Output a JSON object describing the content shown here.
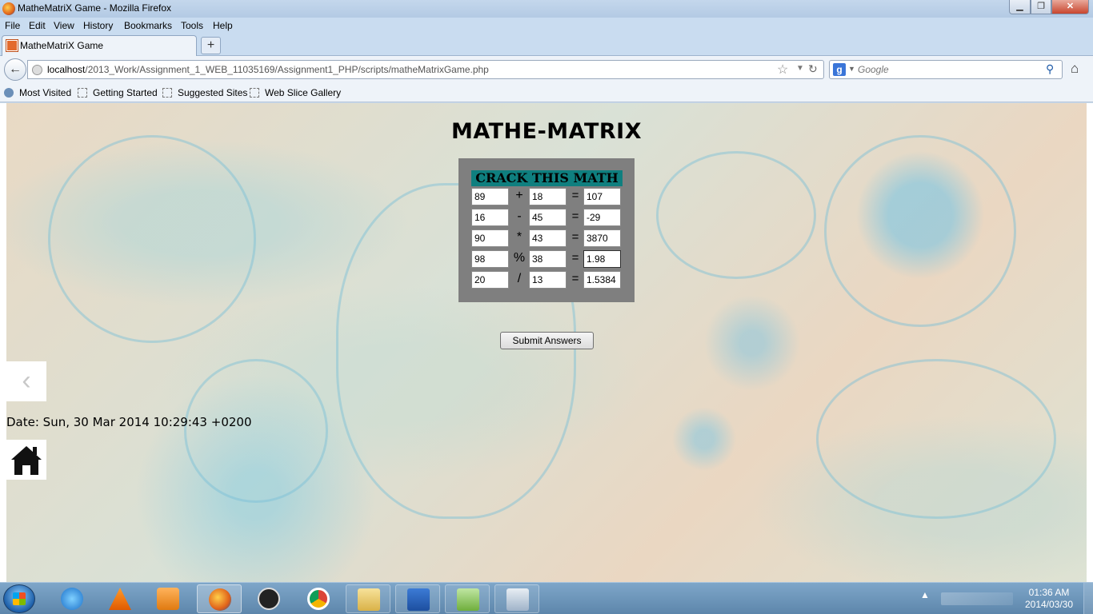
{
  "window": {
    "title": "MatheMatriX Game - Mozilla Firefox",
    "minimize": "▁",
    "maximize": "❐",
    "close": "✕"
  },
  "menu": [
    "File",
    "Edit",
    "View",
    "History",
    "Bookmarks",
    "Tools",
    "Help"
  ],
  "tab": {
    "label": "MatheMatriX Game",
    "new_tab": "+"
  },
  "nav": {
    "back": "←",
    "url_host": "localhost",
    "url_path": "/2013_Work/Assignment_1_WEB_11035169/Assignment1_PHP/scripts/matheMatrixGame.php",
    "star": "☆",
    "dropdown": "▼",
    "reload": "↻",
    "search_engine": "g",
    "search_placeholder": "Google",
    "search_icon": "⚲",
    "home": "⌂"
  },
  "bookmarks": [
    "Most Visited",
    "Getting Started",
    "Suggested Sites",
    "Web Slice Gallery"
  ],
  "page": {
    "title": "MATHE-MATRIX",
    "puzzle_header": "CRACK THIS MATH",
    "rows": [
      {
        "a": "89",
        "op": "+",
        "b": "18",
        "eq": "=",
        "answer": "107"
      },
      {
        "a": "16",
        "op": "-",
        "b": "45",
        "eq": "=",
        "answer": "-29"
      },
      {
        "a": "90",
        "op": "*",
        "b": "43",
        "eq": "=",
        "answer": "3870"
      },
      {
        "a": "98",
        "op": "%",
        "b": "38",
        "eq": "=",
        "answer": "1.98"
      },
      {
        "a": "20",
        "op": "/",
        "b": "13",
        "eq": "=",
        "answer": "1.5384"
      }
    ],
    "submit_label": "Submit Answers",
    "prev_arrow": "‹",
    "date_text": "Date: Sun, 30 Mar 2014 10:29:43 +0200"
  },
  "taskbar": {
    "clock_time": "01:36 AM",
    "clock_date": "2014/03/30",
    "tray_icons": "▲"
  }
}
